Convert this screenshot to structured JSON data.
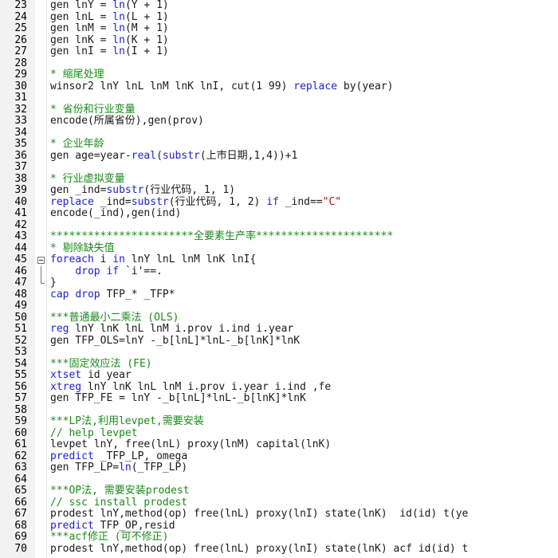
{
  "colors": {
    "plain": "#1a1a1a",
    "keyword": "#1d1dd6",
    "function": "#1d1dd6",
    "comment": "#1a8a1a",
    "string": "#a31515",
    "gutter_bg": "#f2f2f2"
  },
  "lines": [
    {
      "n": "23",
      "fold": "",
      "tokens": [
        {
          "t": "gen lnY = ",
          "c": "plain"
        },
        {
          "t": "ln",
          "c": "function"
        },
        {
          "t": "(Y + 1)",
          "c": "plain"
        }
      ]
    },
    {
      "n": "24",
      "fold": "",
      "tokens": [
        {
          "t": "gen lnL = ",
          "c": "plain"
        },
        {
          "t": "ln",
          "c": "function"
        },
        {
          "t": "(L + 1)",
          "c": "plain"
        }
      ]
    },
    {
      "n": "25",
      "fold": "",
      "tokens": [
        {
          "t": "gen lnM = ",
          "c": "plain"
        },
        {
          "t": "ln",
          "c": "function"
        },
        {
          "t": "(M + 1)",
          "c": "plain"
        }
      ]
    },
    {
      "n": "26",
      "fold": "",
      "tokens": [
        {
          "t": "gen lnK = ",
          "c": "plain"
        },
        {
          "t": "ln",
          "c": "function"
        },
        {
          "t": "(K + 1)",
          "c": "plain"
        }
      ]
    },
    {
      "n": "27",
      "fold": "",
      "tokens": [
        {
          "t": "gen lnI = ",
          "c": "plain"
        },
        {
          "t": "ln",
          "c": "function"
        },
        {
          "t": "(I + 1)",
          "c": "plain"
        }
      ]
    },
    {
      "n": "28",
      "fold": "",
      "tokens": []
    },
    {
      "n": "29",
      "fold": "",
      "tokens": [
        {
          "t": "* 缩尾处理",
          "c": "comment"
        }
      ]
    },
    {
      "n": "30",
      "fold": "",
      "tokens": [
        {
          "t": "winsor2 lnY lnL lnM lnK lnI, cut(1 99) ",
          "c": "plain"
        },
        {
          "t": "replace",
          "c": "keyword"
        },
        {
          "t": " by(year)",
          "c": "plain"
        }
      ]
    },
    {
      "n": "31",
      "fold": "",
      "tokens": []
    },
    {
      "n": "32",
      "fold": "",
      "tokens": [
        {
          "t": "* 省份和行业变量",
          "c": "comment"
        }
      ]
    },
    {
      "n": "33",
      "fold": "",
      "tokens": [
        {
          "t": "encode(所属省份),gen(prov)",
          "c": "plain"
        }
      ]
    },
    {
      "n": "34",
      "fold": "",
      "tokens": []
    },
    {
      "n": "35",
      "fold": "",
      "tokens": [
        {
          "t": "* 企业年龄",
          "c": "comment"
        }
      ]
    },
    {
      "n": "36",
      "fold": "",
      "tokens": [
        {
          "t": "gen age=year-",
          "c": "plain"
        },
        {
          "t": "real",
          "c": "function"
        },
        {
          "t": "(",
          "c": "plain"
        },
        {
          "t": "substr",
          "c": "function"
        },
        {
          "t": "(上市日期,1,4))+1",
          "c": "plain"
        }
      ]
    },
    {
      "n": "37",
      "fold": "",
      "tokens": []
    },
    {
      "n": "38",
      "fold": "",
      "tokens": [
        {
          "t": "* 行业虚拟变量",
          "c": "comment"
        }
      ]
    },
    {
      "n": "39",
      "fold": "",
      "tokens": [
        {
          "t": "gen _ind=",
          "c": "plain"
        },
        {
          "t": "substr",
          "c": "function"
        },
        {
          "t": "(行业代码, 1, 1)",
          "c": "plain"
        }
      ]
    },
    {
      "n": "40",
      "fold": "",
      "tokens": [
        {
          "t": "replace",
          "c": "keyword"
        },
        {
          "t": " _ind=",
          "c": "plain"
        },
        {
          "t": "substr",
          "c": "function"
        },
        {
          "t": "(行业代码, 1, 2) ",
          "c": "plain"
        },
        {
          "t": "if",
          "c": "keyword"
        },
        {
          "t": " _ind==",
          "c": "plain"
        },
        {
          "t": "\"C\"",
          "c": "string"
        }
      ]
    },
    {
      "n": "41",
      "fold": "",
      "tokens": [
        {
          "t": "encode(_ind),gen(ind)",
          "c": "plain"
        }
      ]
    },
    {
      "n": "42",
      "fold": "",
      "tokens": []
    },
    {
      "n": "43",
      "fold": "",
      "tokens": [
        {
          "t": "***********************全要素生产率**********************",
          "c": "comment"
        }
      ]
    },
    {
      "n": "44",
      "fold": "",
      "tokens": [
        {
          "t": "* 剔除缺失值",
          "c": "comment"
        }
      ]
    },
    {
      "n": "45",
      "fold": "box",
      "tokens": [
        {
          "t": "foreach",
          "c": "keyword"
        },
        {
          "t": " i ",
          "c": "plain"
        },
        {
          "t": "in",
          "c": "keyword"
        },
        {
          "t": " lnY lnL lnM lnK lnI{",
          "c": "plain"
        }
      ]
    },
    {
      "n": "46",
      "fold": "bar",
      "tokens": [
        {
          "t": "    ",
          "c": "plain"
        },
        {
          "t": "drop",
          "c": "keyword"
        },
        {
          "t": " ",
          "c": "plain"
        },
        {
          "t": "if",
          "c": "keyword"
        },
        {
          "t": " ",
          "c": "plain"
        },
        {
          "t": "`i'",
          "c": "macro"
        },
        {
          "t": "==.",
          "c": "plain"
        }
      ]
    },
    {
      "n": "47",
      "fold": "end",
      "tokens": [
        {
          "t": "}",
          "c": "plain"
        }
      ]
    },
    {
      "n": "48",
      "fold": "",
      "tokens": [
        {
          "t": "cap",
          "c": "keyword"
        },
        {
          "t": " ",
          "c": "plain"
        },
        {
          "t": "drop",
          "c": "keyword"
        },
        {
          "t": " TFP_* _TFP*",
          "c": "plain"
        }
      ]
    },
    {
      "n": "49",
      "fold": "",
      "tokens": []
    },
    {
      "n": "50",
      "fold": "",
      "tokens": [
        {
          "t": "***普通最小二乘法 (OLS)",
          "c": "comment"
        }
      ]
    },
    {
      "n": "51",
      "fold": "",
      "tokens": [
        {
          "t": "reg",
          "c": "keyword"
        },
        {
          "t": " lnY lnK lnL lnM i.prov i.ind i.year",
          "c": "plain"
        }
      ]
    },
    {
      "n": "52",
      "fold": "",
      "tokens": [
        {
          "t": "gen TFP_OLS=lnY -_b[lnL]*lnL-_b[lnK]*lnK",
          "c": "plain"
        }
      ]
    },
    {
      "n": "53",
      "fold": "",
      "tokens": []
    },
    {
      "n": "54",
      "fold": "",
      "tokens": [
        {
          "t": "***固定效应法 (FE)",
          "c": "comment"
        }
      ]
    },
    {
      "n": "55",
      "fold": "",
      "tokens": [
        {
          "t": "xtset",
          "c": "keyword"
        },
        {
          "t": " id year",
          "c": "plain"
        }
      ]
    },
    {
      "n": "56",
      "fold": "",
      "tokens": [
        {
          "t": "xtreg",
          "c": "keyword"
        },
        {
          "t": " lnY lnK lnL lnM i.prov i.year i.ind ,fe",
          "c": "plain"
        }
      ]
    },
    {
      "n": "57",
      "fold": "",
      "tokens": [
        {
          "t": "gen TFP_FE = lnY -_b[lnL]*lnL-_b[lnK]*lnK",
          "c": "plain"
        }
      ]
    },
    {
      "n": "58",
      "fold": "",
      "tokens": []
    },
    {
      "n": "59",
      "fold": "",
      "tokens": [
        {
          "t": "***LP法,利用levpet,需要安装",
          "c": "comment"
        }
      ]
    },
    {
      "n": "60",
      "fold": "",
      "tokens": [
        {
          "t": "// help levpet",
          "c": "comment"
        }
      ]
    },
    {
      "n": "61",
      "fold": "",
      "tokens": [
        {
          "t": "levpet lnY, free(lnL) proxy(lnM) capital(lnK)",
          "c": "plain"
        }
      ]
    },
    {
      "n": "62",
      "fold": "",
      "tokens": [
        {
          "t": "predict",
          "c": "keyword"
        },
        {
          "t": " _TFP_LP, omega",
          "c": "plain"
        }
      ]
    },
    {
      "n": "63",
      "fold": "",
      "tokens": [
        {
          "t": "gen TFP_LP=",
          "c": "plain"
        },
        {
          "t": "ln",
          "c": "function"
        },
        {
          "t": "(_TFP_LP)",
          "c": "plain"
        }
      ]
    },
    {
      "n": "64",
      "fold": "",
      "tokens": []
    },
    {
      "n": "65",
      "fold": "",
      "tokens": [
        {
          "t": "***OP法, 需要安装prodest",
          "c": "comment"
        }
      ]
    },
    {
      "n": "66",
      "fold": "",
      "tokens": [
        {
          "t": "// ssc install prodest",
          "c": "comment"
        }
      ]
    },
    {
      "n": "67",
      "fold": "",
      "tokens": [
        {
          "t": "prodest lnY,method(op) free(lnL) proxy(lnI) state(lnK)  id(id) t(ye",
          "c": "plain"
        }
      ]
    },
    {
      "n": "68",
      "fold": "",
      "tokens": [
        {
          "t": "predict",
          "c": "keyword"
        },
        {
          "t": " TFP_OP,resid",
          "c": "plain"
        }
      ]
    },
    {
      "n": "69",
      "fold": "",
      "tokens": [
        {
          "t": "***acf修正 (可不修正)",
          "c": "comment"
        }
      ]
    },
    {
      "n": "70",
      "fold": "",
      "tokens": [
        {
          "t": "prodest lnY,method(op) free(lnL) proxy(lnI) state(lnK) acf id(id) t",
          "c": "plain"
        }
      ]
    }
  ]
}
